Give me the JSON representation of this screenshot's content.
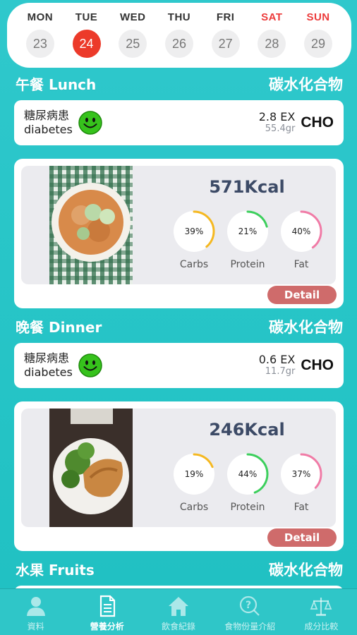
{
  "calendar": {
    "days": [
      {
        "name": "MON",
        "num": "23"
      },
      {
        "name": "TUE",
        "num": "24"
      },
      {
        "name": "WED",
        "num": "25"
      },
      {
        "name": "THU",
        "num": "26"
      },
      {
        "name": "FRI",
        "num": "27"
      },
      {
        "name": "SAT",
        "num": "28"
      },
      {
        "name": "SUN",
        "num": "29"
      }
    ],
    "selected": "24",
    "weekend_color": "#ec3a3a",
    "selected_color": "#ec3a2a"
  },
  "lunch": {
    "title": "午餐 Lunch",
    "right_label": "碳水化合物",
    "diabetes_line1": "糖尿病患",
    "diabetes_line2": "diabetes",
    "smiley_icon": "green-smiley-icon",
    "ex": "2.8 EX",
    "grams": "55.4gr",
    "cho": "CHO",
    "kcal": "571Kcal",
    "rings": [
      {
        "pct": "39%",
        "label": "Carbs",
        "value": 0.39,
        "color": "#f5b820"
      },
      {
        "pct": "21%",
        "label": "Protein",
        "value": 0.21,
        "color": "#3ccf5c"
      },
      {
        "pct": "40%",
        "label": "Fat",
        "value": 0.4,
        "color": "#f07ba6"
      }
    ],
    "detail": "Detail"
  },
  "dinner": {
    "title": "晚餐 Dinner",
    "right_label": "碳水化合物",
    "diabetes_line1": "糖尿病患",
    "diabetes_line2": "diabetes",
    "smiley_icon": "green-smiley-icon",
    "ex": "0.6 EX",
    "grams": "11.7gr",
    "cho": "CHO",
    "kcal": "246Kcal",
    "rings": [
      {
        "pct": "19%",
        "label": "Carbs",
        "value": 0.19,
        "color": "#f5b820"
      },
      {
        "pct": "44%",
        "label": "Protein",
        "value": 0.44,
        "color": "#3ccf5c"
      },
      {
        "pct": "37%",
        "label": "Fat",
        "value": 0.37,
        "color": "#f07ba6"
      }
    ],
    "detail": "Detail"
  },
  "fruits": {
    "title": "水果 Fruits",
    "right_label": "碳水化合物"
  },
  "tabs": [
    {
      "label": "資料",
      "icon": "person-icon"
    },
    {
      "label": "營養分析",
      "icon": "document-icon"
    },
    {
      "label": "飲食紀錄",
      "icon": "home-icon"
    },
    {
      "label": "食物份量介紹",
      "icon": "question-bubble-icon"
    },
    {
      "label": "成分比較",
      "icon": "balance-scale-icon"
    }
  ],
  "active_tab": "營養分析"
}
